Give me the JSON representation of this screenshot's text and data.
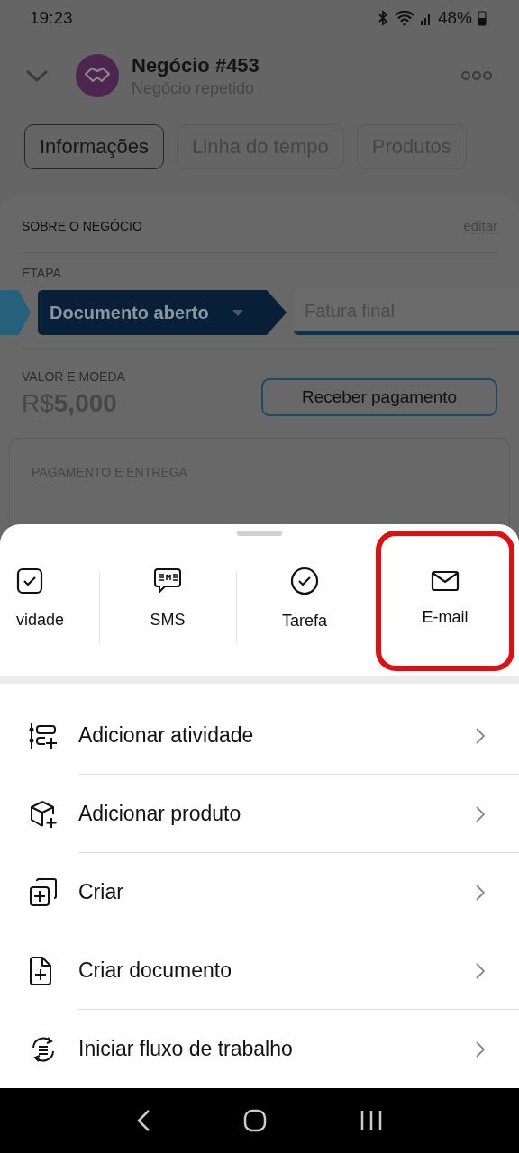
{
  "status_bar": {
    "time": "19:23",
    "battery": "48%"
  },
  "header": {
    "title": "Negócio #453",
    "subtitle": "Negócio repetido"
  },
  "tabs": [
    {
      "label": "Informações",
      "selected": true
    },
    {
      "label": "Linha do tempo",
      "selected": false
    },
    {
      "label": "Produtos",
      "selected": false
    }
  ],
  "card": {
    "heading": "SOBRE O NEGÓCIO",
    "edit_link": "editar",
    "stage_label": "ETAPA",
    "stages": [
      {
        "kind": "past"
      },
      {
        "kind": "current",
        "label": "Documento aberto"
      },
      {
        "kind": "next",
        "label": "Fatura final"
      }
    ],
    "amount_label": "VALOR E MOEDA",
    "amount": "R$**5,000**",
    "pay_button": "Receber pagamento",
    "section_heading": "PAGAMENTO E ENTREGA"
  },
  "quick_actions": [
    {
      "kind": "activity",
      "label": "vidade",
      "highlighted": false
    },
    {
      "kind": "sms",
      "label": "SMS",
      "highlighted": false
    },
    {
      "kind": "task",
      "label": "Tarefa",
      "highlighted": false
    },
    {
      "kind": "email",
      "label": "E-mail",
      "highlighted": true
    }
  ],
  "menu": [
    {
      "kind": "activity",
      "label": "Adicionar atividade"
    },
    {
      "kind": "product",
      "label": "Adicionar produto"
    },
    {
      "kind": "create",
      "label": "Criar"
    },
    {
      "kind": "document",
      "label": "Criar documento"
    },
    {
      "kind": "workflow",
      "label": "Iniciar fluxo de trabalho"
    }
  ]
}
